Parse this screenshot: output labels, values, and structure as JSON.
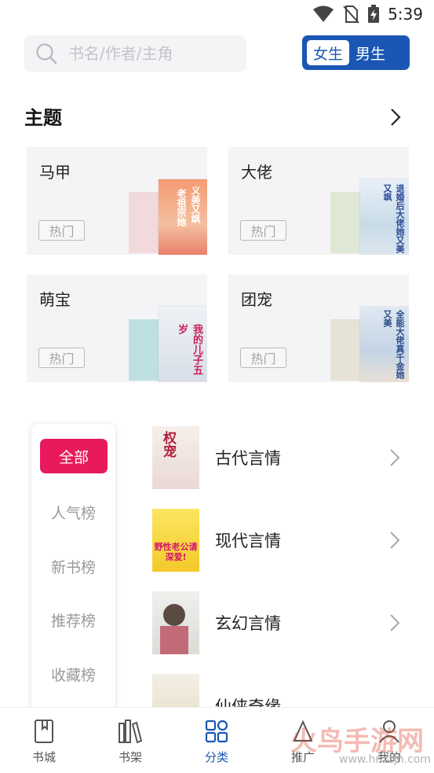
{
  "status_bar": {
    "time": "5:39"
  },
  "search": {
    "placeholder": "书名/作者/主角",
    "value": ""
  },
  "gender_toggle": {
    "female": "女生",
    "male": "男生",
    "selected": "女生"
  },
  "theme_section": {
    "title": "主题"
  },
  "theme_cards": [
    {
      "title": "马甲",
      "badge": "热门",
      "front_cover_text": "义美又飒",
      "front_cover_text2": "老祖宗她"
    },
    {
      "title": "大佬",
      "badge": "热门",
      "front_cover_text": "退婚后大佬她又美又飒"
    },
    {
      "title": "萌宝",
      "badge": "热门",
      "front_cover_text": "我的儿子五岁"
    },
    {
      "title": "团宠",
      "badge": "热门",
      "front_cover_text": "全能大佬真千金她又美"
    }
  ],
  "rank_tabs": [
    {
      "label": "全部",
      "active": true
    },
    {
      "label": "人气榜",
      "active": false
    },
    {
      "label": "新书榜",
      "active": false
    },
    {
      "label": "推荐榜",
      "active": false
    },
    {
      "label": "收藏榜",
      "active": false
    }
  ],
  "categories": [
    {
      "label": "古代言情",
      "cover_text": "权宠"
    },
    {
      "label": "现代言情",
      "cover_text": "野性老公请深爱!"
    },
    {
      "label": "玄幻言情",
      "cover_text": ""
    },
    {
      "label": "仙侠奇缘",
      "cover_text": ""
    }
  ],
  "bottom_nav": [
    {
      "label": "书城",
      "icon": "book-icon",
      "active": false
    },
    {
      "label": "书架",
      "icon": "bookshelf-icon",
      "active": false
    },
    {
      "label": "分类",
      "icon": "grid-icon",
      "active": true
    },
    {
      "label": "推广",
      "icon": "promote-icon",
      "active": false
    },
    {
      "label": "我的",
      "icon": "profile-icon",
      "active": false
    }
  ],
  "watermark": {
    "text": "火鸟手游网",
    "url": "www.hnzzjh.com"
  },
  "colors": {
    "brand_blue": "#1a57b4",
    "accent_pink": "#e81a5c",
    "card_bg": "#f4f4f6"
  }
}
